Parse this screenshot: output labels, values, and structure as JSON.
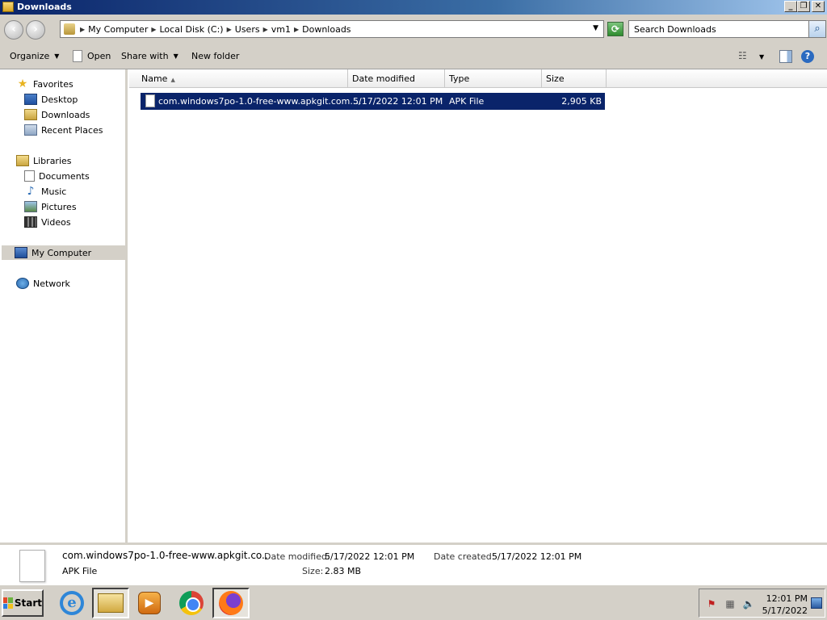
{
  "window": {
    "title": "Downloads",
    "buttons": {
      "minimize": "_",
      "maximize": "❐",
      "close": "✕"
    }
  },
  "address": {
    "crumbs": [
      "My Computer",
      "Local Disk (C:)",
      "Users",
      "vm1",
      "Downloads"
    ],
    "search_placeholder": "Search Downloads"
  },
  "commands": {
    "organize": "Organize",
    "open": "Open",
    "share_with": "Share with",
    "new_folder": "New folder"
  },
  "nav": {
    "favorites": "Favorites",
    "desktop": "Desktop",
    "downloads": "Downloads",
    "recent_places": "Recent Places",
    "libraries": "Libraries",
    "documents": "Documents",
    "music": "Music",
    "pictures": "Pictures",
    "videos": "Videos",
    "my_computer": "My Computer",
    "network": "Network"
  },
  "columns": {
    "name": "Name",
    "date_modified": "Date modified",
    "type": "Type",
    "size": "Size"
  },
  "files": [
    {
      "name": "com.windows7po-1.0-free-www.apkgit.com....",
      "date_modified": "5/17/2022 12:01 PM",
      "type": "APK File",
      "size": "2,905 KB",
      "selected": true
    }
  ],
  "details": {
    "name": "com.windows7po-1.0-free-www.apkgit.co...",
    "type": "APK File",
    "date_modified_label": "Date modified:",
    "date_modified": "5/17/2022 12:01 PM",
    "date_created_label": "Date created:",
    "date_created": "5/17/2022 12:01 PM",
    "size_label": "Size:",
    "size": "2.83 MB"
  },
  "taskbar": {
    "start": "Start",
    "apps": [
      "internet-explorer",
      "windows-explorer",
      "windows-media-player",
      "google-chrome",
      "firefox"
    ],
    "clock_time": "12:01 PM",
    "clock_date": "5/17/2022"
  },
  "colors": {
    "selection": "#0a246a",
    "chrome": "#d4d0c8"
  }
}
